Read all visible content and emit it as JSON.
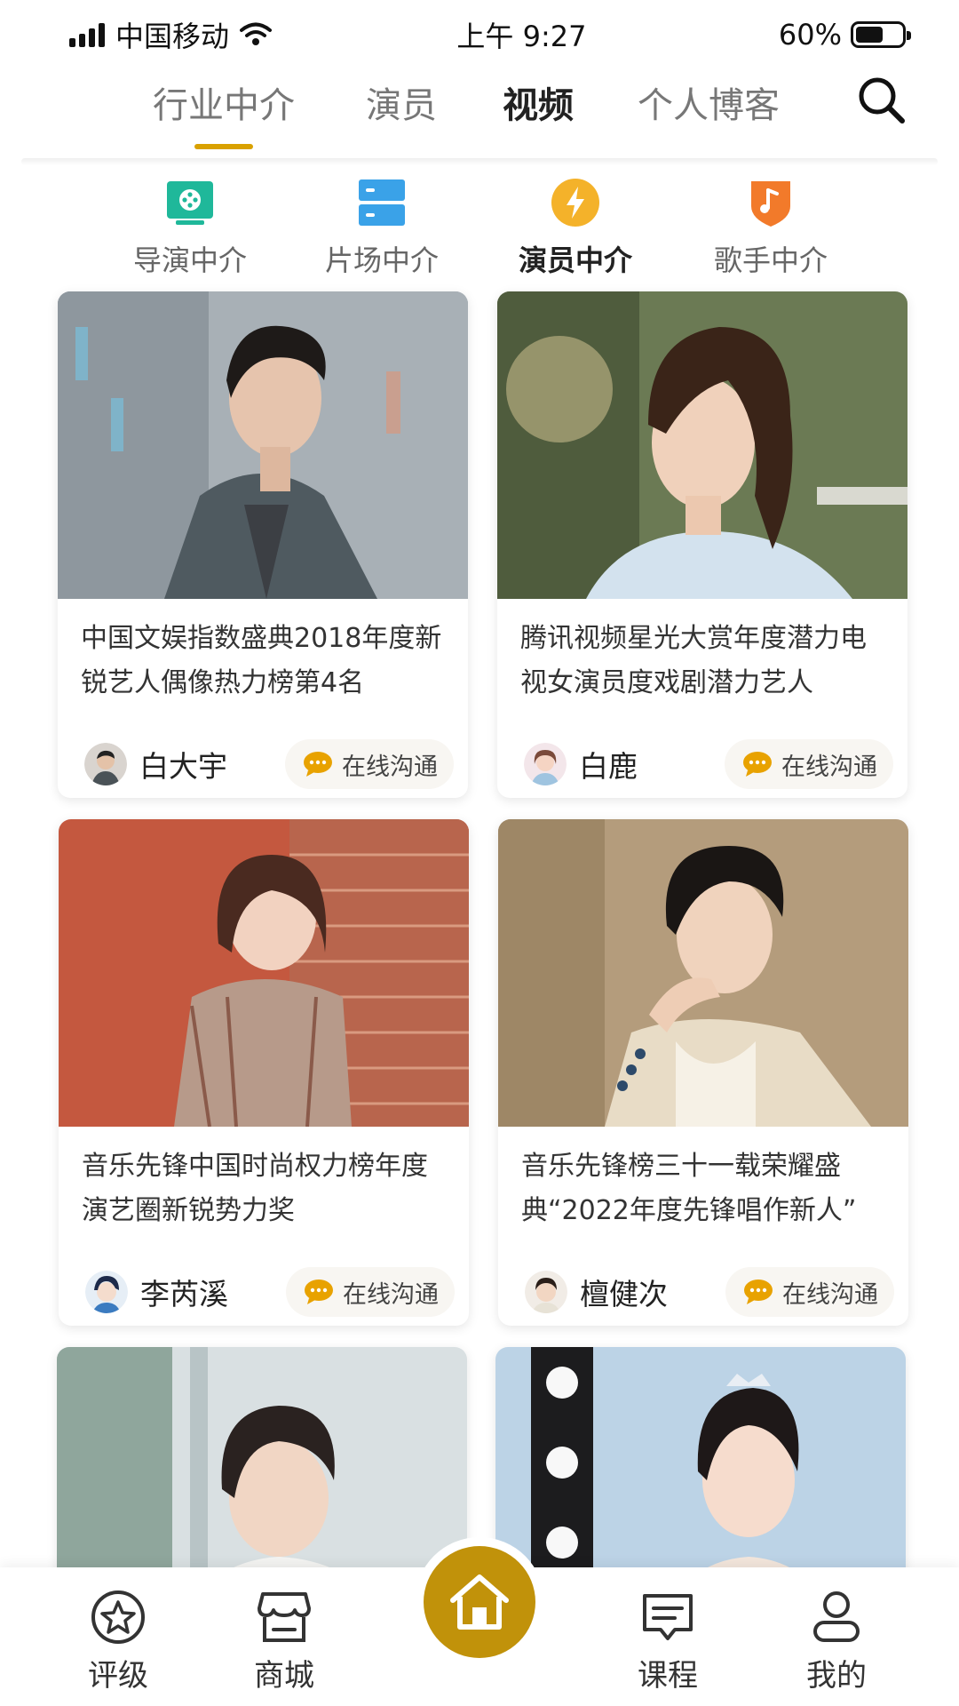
{
  "status_bar": {
    "carrier": "中国移动",
    "time": "上午 9:27",
    "battery": "60%",
    "battery_level": 0.6
  },
  "top_tabs": [
    {
      "label": "行业中介",
      "state": "underlined"
    },
    {
      "label": "演员",
      "state": "normal"
    },
    {
      "label": "视频",
      "state": "bold"
    },
    {
      "label": "个人博客",
      "state": "normal"
    }
  ],
  "categories": [
    {
      "label": "导演中介",
      "icon": "film-reel-icon",
      "color": "#1fb89a"
    },
    {
      "label": "片场中介",
      "icon": "server-icon",
      "color": "#3aa2e8"
    },
    {
      "label": "演员中介",
      "icon": "lightning-icon",
      "color": "#f4b22a",
      "active": true
    },
    {
      "label": "歌手中介",
      "icon": "music-shield-icon",
      "color": "#f27a2a"
    }
  ],
  "cards": [
    {
      "desc": "中国文娱指数盛典2018年度新锐艺人偶像热力榜第4名",
      "name": "白大宇",
      "chat": "在线沟通"
    },
    {
      "desc": "腾讯视频星光大赏年度潜力电视女演员度戏剧潜力艺人",
      "name": "白鹿",
      "chat": "在线沟通"
    },
    {
      "desc": "音乐先锋中国时尚权力榜年度演艺圈新锐势力奖",
      "name": "李芮溪",
      "chat": "在线沟通"
    },
    {
      "desc": "音乐先锋榜三十一载荣耀盛典“2022年度先锋唱作新人”",
      "name": "檀健次",
      "chat": "在线沟通"
    }
  ],
  "bottom_nav": [
    {
      "label": "评级",
      "icon": "star-circle-icon"
    },
    {
      "label": "商城",
      "icon": "store-icon"
    },
    {
      "label": "",
      "icon": "home-icon"
    },
    {
      "label": "课程",
      "icon": "course-board-icon"
    },
    {
      "label": "我的",
      "icon": "user-icon"
    }
  ],
  "colors": {
    "accent": "#d9a100",
    "home_button": "#c1920a",
    "chat_icon": "#e8a200"
  }
}
